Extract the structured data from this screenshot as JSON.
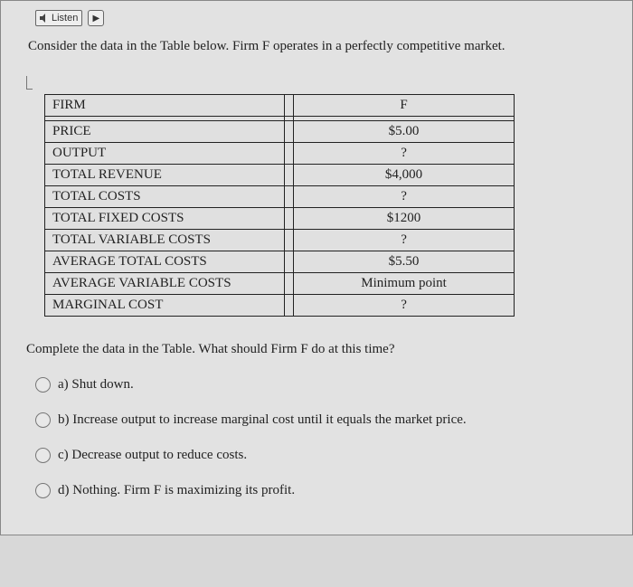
{
  "toolbar": {
    "listen": "Listen",
    "play_icon": "▶"
  },
  "prompt_text": "Consider the data in the Table below.  Firm F operates in a perfectly competitive market.",
  "table": {
    "header_left": "FIRM",
    "header_right": "F",
    "rows": [
      {
        "label": "PRICE",
        "value": "$5.00"
      },
      {
        "label": "OUTPUT",
        "value": "?"
      },
      {
        "label": "TOTAL REVENUE",
        "value": "$4,000"
      },
      {
        "label": "TOTAL COSTS",
        "value": "?"
      },
      {
        "label": "TOTAL FIXED COSTS",
        "value": "$1200"
      },
      {
        "label": "TOTAL VARIABLE COSTS",
        "value": "?"
      },
      {
        "label": "AVERAGE TOTAL COSTS",
        "value": "$5.50"
      },
      {
        "label": "AVERAGE VARIABLE COSTS",
        "value": "Minimum point"
      },
      {
        "label": "MARGINAL COST",
        "value": "?"
      }
    ]
  },
  "question_text": "Complete the data in the Table.  What should Firm F do at this time?",
  "options": {
    "a": "a)  Shut down.",
    "b": "b)  Increase output to increase marginal cost until it equals the market price.",
    "c": "c)  Decrease output to reduce costs.",
    "d": "d)  Nothing.  Firm F is maximizing its profit."
  }
}
